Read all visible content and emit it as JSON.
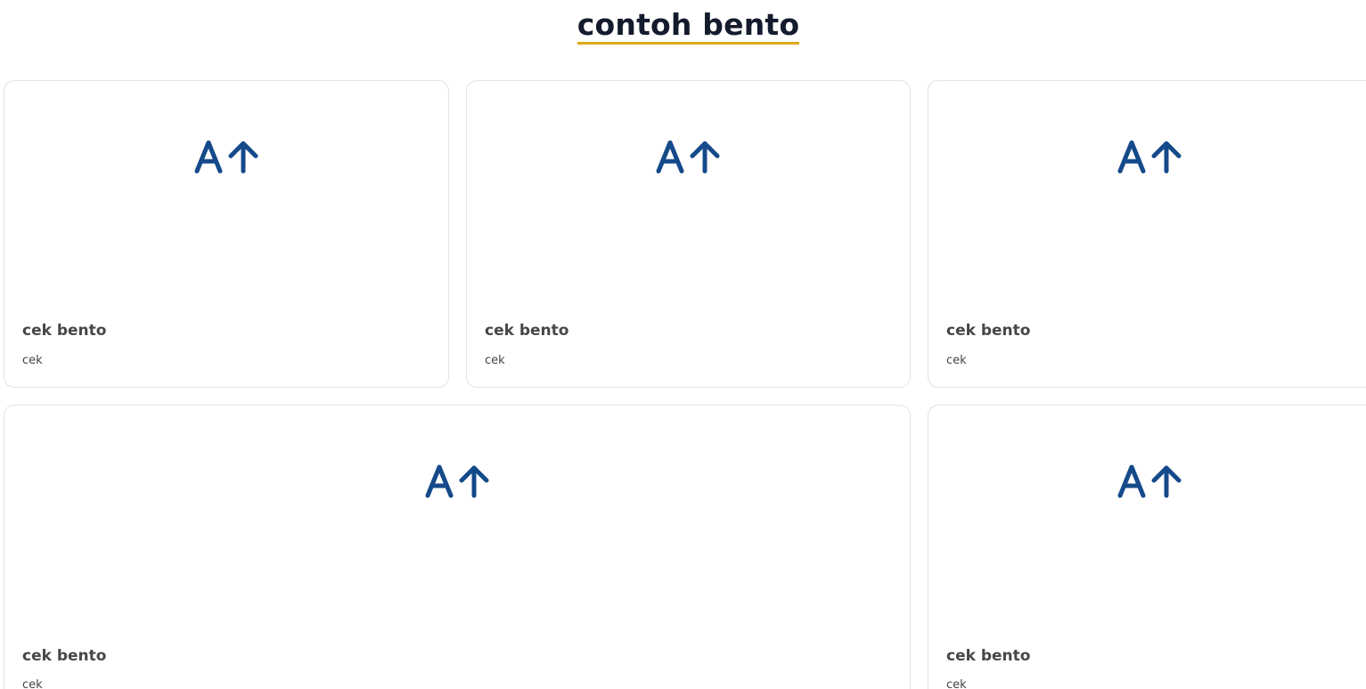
{
  "page": {
    "title": "contoh bento",
    "title_underline_color": "#e0a61c",
    "logo_color": "#154a8a",
    "logo_icon": "ai-arrow-up-logo"
  },
  "cards": [
    {
      "title": "cek bento",
      "description": "cek"
    },
    {
      "title": "cek bento",
      "description": "cek"
    },
    {
      "title": "cek bento",
      "description": "cek"
    },
    {
      "title": "cek bento",
      "description": "cek"
    },
    {
      "title": "cek bento",
      "description": "cek"
    }
  ]
}
